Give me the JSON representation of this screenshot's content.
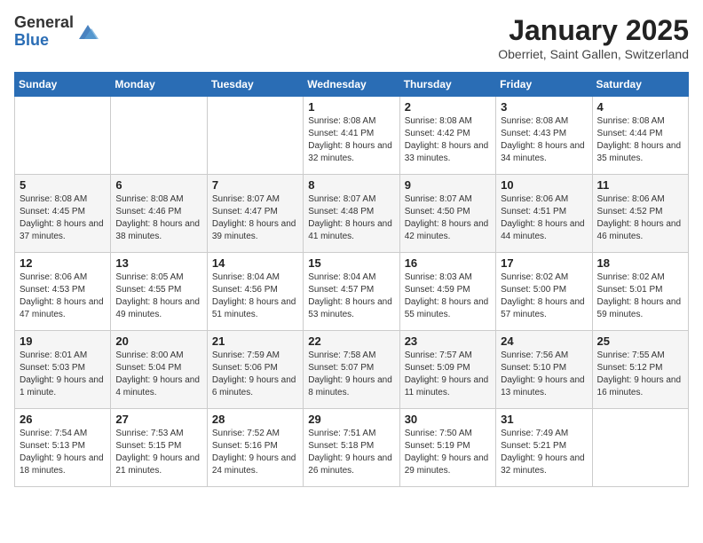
{
  "header": {
    "logo_general": "General",
    "logo_blue": "Blue",
    "month_title": "January 2025",
    "location": "Oberriet, Saint Gallen, Switzerland"
  },
  "days_of_week": [
    "Sunday",
    "Monday",
    "Tuesday",
    "Wednesday",
    "Thursday",
    "Friday",
    "Saturday"
  ],
  "weeks": [
    [
      {
        "num": "",
        "info": ""
      },
      {
        "num": "",
        "info": ""
      },
      {
        "num": "",
        "info": ""
      },
      {
        "num": "1",
        "info": "Sunrise: 8:08 AM\nSunset: 4:41 PM\nDaylight: 8 hours and 32 minutes."
      },
      {
        "num": "2",
        "info": "Sunrise: 8:08 AM\nSunset: 4:42 PM\nDaylight: 8 hours and 33 minutes."
      },
      {
        "num": "3",
        "info": "Sunrise: 8:08 AM\nSunset: 4:43 PM\nDaylight: 8 hours and 34 minutes."
      },
      {
        "num": "4",
        "info": "Sunrise: 8:08 AM\nSunset: 4:44 PM\nDaylight: 8 hours and 35 minutes."
      }
    ],
    [
      {
        "num": "5",
        "info": "Sunrise: 8:08 AM\nSunset: 4:45 PM\nDaylight: 8 hours and 37 minutes."
      },
      {
        "num": "6",
        "info": "Sunrise: 8:08 AM\nSunset: 4:46 PM\nDaylight: 8 hours and 38 minutes."
      },
      {
        "num": "7",
        "info": "Sunrise: 8:07 AM\nSunset: 4:47 PM\nDaylight: 8 hours and 39 minutes."
      },
      {
        "num": "8",
        "info": "Sunrise: 8:07 AM\nSunset: 4:48 PM\nDaylight: 8 hours and 41 minutes."
      },
      {
        "num": "9",
        "info": "Sunrise: 8:07 AM\nSunset: 4:50 PM\nDaylight: 8 hours and 42 minutes."
      },
      {
        "num": "10",
        "info": "Sunrise: 8:06 AM\nSunset: 4:51 PM\nDaylight: 8 hours and 44 minutes."
      },
      {
        "num": "11",
        "info": "Sunrise: 8:06 AM\nSunset: 4:52 PM\nDaylight: 8 hours and 46 minutes."
      }
    ],
    [
      {
        "num": "12",
        "info": "Sunrise: 8:06 AM\nSunset: 4:53 PM\nDaylight: 8 hours and 47 minutes."
      },
      {
        "num": "13",
        "info": "Sunrise: 8:05 AM\nSunset: 4:55 PM\nDaylight: 8 hours and 49 minutes."
      },
      {
        "num": "14",
        "info": "Sunrise: 8:04 AM\nSunset: 4:56 PM\nDaylight: 8 hours and 51 minutes."
      },
      {
        "num": "15",
        "info": "Sunrise: 8:04 AM\nSunset: 4:57 PM\nDaylight: 8 hours and 53 minutes."
      },
      {
        "num": "16",
        "info": "Sunrise: 8:03 AM\nSunset: 4:59 PM\nDaylight: 8 hours and 55 minutes."
      },
      {
        "num": "17",
        "info": "Sunrise: 8:02 AM\nSunset: 5:00 PM\nDaylight: 8 hours and 57 minutes."
      },
      {
        "num": "18",
        "info": "Sunrise: 8:02 AM\nSunset: 5:01 PM\nDaylight: 8 hours and 59 minutes."
      }
    ],
    [
      {
        "num": "19",
        "info": "Sunrise: 8:01 AM\nSunset: 5:03 PM\nDaylight: 9 hours and 1 minute."
      },
      {
        "num": "20",
        "info": "Sunrise: 8:00 AM\nSunset: 5:04 PM\nDaylight: 9 hours and 4 minutes."
      },
      {
        "num": "21",
        "info": "Sunrise: 7:59 AM\nSunset: 5:06 PM\nDaylight: 9 hours and 6 minutes."
      },
      {
        "num": "22",
        "info": "Sunrise: 7:58 AM\nSunset: 5:07 PM\nDaylight: 9 hours and 8 minutes."
      },
      {
        "num": "23",
        "info": "Sunrise: 7:57 AM\nSunset: 5:09 PM\nDaylight: 9 hours and 11 minutes."
      },
      {
        "num": "24",
        "info": "Sunrise: 7:56 AM\nSunset: 5:10 PM\nDaylight: 9 hours and 13 minutes."
      },
      {
        "num": "25",
        "info": "Sunrise: 7:55 AM\nSunset: 5:12 PM\nDaylight: 9 hours and 16 minutes."
      }
    ],
    [
      {
        "num": "26",
        "info": "Sunrise: 7:54 AM\nSunset: 5:13 PM\nDaylight: 9 hours and 18 minutes."
      },
      {
        "num": "27",
        "info": "Sunrise: 7:53 AM\nSunset: 5:15 PM\nDaylight: 9 hours and 21 minutes."
      },
      {
        "num": "28",
        "info": "Sunrise: 7:52 AM\nSunset: 5:16 PM\nDaylight: 9 hours and 24 minutes."
      },
      {
        "num": "29",
        "info": "Sunrise: 7:51 AM\nSunset: 5:18 PM\nDaylight: 9 hours and 26 minutes."
      },
      {
        "num": "30",
        "info": "Sunrise: 7:50 AM\nSunset: 5:19 PM\nDaylight: 9 hours and 29 minutes."
      },
      {
        "num": "31",
        "info": "Sunrise: 7:49 AM\nSunset: 5:21 PM\nDaylight: 9 hours and 32 minutes."
      },
      {
        "num": "",
        "info": ""
      }
    ]
  ]
}
